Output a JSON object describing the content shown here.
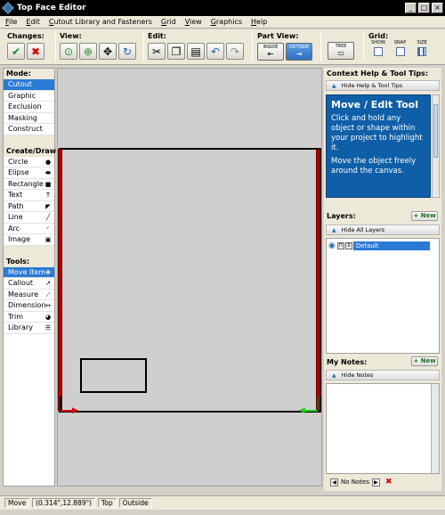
{
  "window": {
    "title": "Top Face Editor",
    "min": "_",
    "max": "□",
    "close": "×"
  },
  "menu": [
    "File",
    "Edit",
    "Cutout Library and Fasteners",
    "Grid",
    "View",
    "Graphics",
    "Help"
  ],
  "toolbar": {
    "changes_label": "Changes:",
    "view_label": "View:",
    "edit_label": "Edit:",
    "partview_label": "Part View:",
    "partview_inside": "INSIDE",
    "partview_outside": "OUTSIDE",
    "tree_label": "TREE",
    "grid_label": "Grid:",
    "grid_show": "SHOW",
    "grid_snap": "SNAP",
    "grid_size": "SIZE"
  },
  "mode": {
    "title": "Mode:",
    "items": [
      "Cutout",
      "Graphic",
      "Exclusion",
      "Masking",
      "Construct"
    ]
  },
  "create": {
    "title": "Create/Draw:",
    "items": [
      "Circle",
      "Elipse",
      "Rectangle",
      "Text",
      "Path",
      "Line",
      "Arc",
      "Image"
    ]
  },
  "tools": {
    "title": "Tools:",
    "items": [
      "Move Item",
      "Callout",
      "Measure",
      "Dimension",
      "Trim",
      "Library"
    ]
  },
  "help": {
    "title": "Context Help & Tool Tips:",
    "hide": "Hide Help & Tool Tips",
    "heading": "Move / Edit Tool",
    "p1": "Click and hold any object or shape within your project to highlight it.",
    "p2": "Move the object freely around the canvas."
  },
  "layers": {
    "title": "Layers:",
    "new": "+ New",
    "hide": "Hide All Layers",
    "items": [
      "Default"
    ]
  },
  "notes": {
    "title": "My Notes:",
    "new": "+ New",
    "hide": "Hide Notes",
    "nav_label": "No Notes"
  },
  "status": {
    "tool": "Move",
    "coords": "(0.314\",12.889\")",
    "face": "Top",
    "view": "Outside"
  },
  "colors": {
    "accent": "#2b7ad6",
    "help_bg": "#0f5fa8",
    "red": "#b80000"
  }
}
